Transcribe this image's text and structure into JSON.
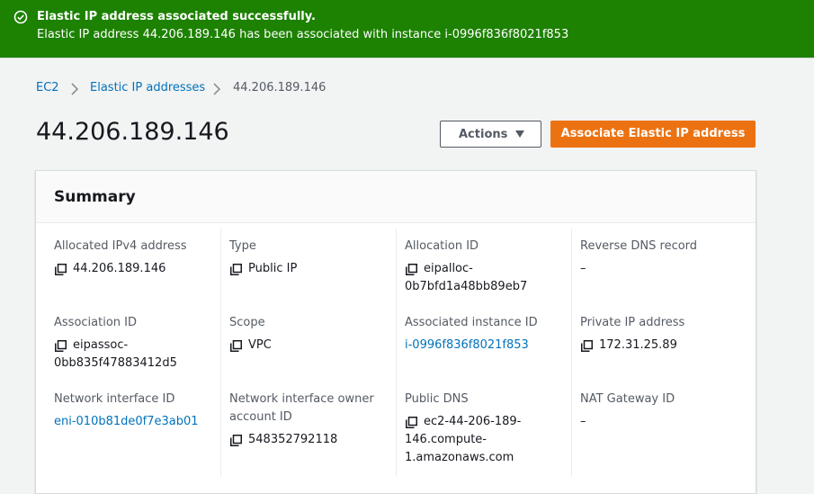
{
  "flash": {
    "title": "Elastic IP address associated successfully.",
    "message": "Elastic IP address 44.206.189.146 has been associated with instance i-0996f836f8021f853",
    "color": "#1d8102"
  },
  "breadcrumb": {
    "items": [
      "EC2",
      "Elastic IP addresses",
      "44.206.189.146"
    ]
  },
  "page": {
    "title": "44.206.189.146"
  },
  "actions": {
    "actions_label": "Actions",
    "associate_label": "Associate Elastic IP address",
    "primary_color": "#ec7211"
  },
  "summary": {
    "heading": "Summary",
    "fields": {
      "allocated_ipv4": {
        "label": "Allocated IPv4 address",
        "value": "44.206.189.146"
      },
      "type": {
        "label": "Type",
        "value": "Public IP"
      },
      "allocation_id": {
        "label": "Allocation ID",
        "value_line1": "eipalloc-",
        "value_line2": "0b7bfd1a48bb89eb7"
      },
      "reverse_dns": {
        "label": "Reverse DNS record",
        "value": "–"
      },
      "association_id": {
        "label": "Association ID",
        "value_line1": "eipassoc-",
        "value_line2": "0bb835f47883412d5"
      },
      "scope": {
        "label": "Scope",
        "value": "VPC"
      },
      "associated_instance": {
        "label": "Associated instance ID",
        "value": "i-0996f836f8021f853"
      },
      "private_ip": {
        "label": "Private IP address",
        "value": "172.31.25.89"
      },
      "eni": {
        "label": "Network interface ID",
        "value": "eni-010b81de0f7e3ab01"
      },
      "eni_owner": {
        "label_line1": "Network interface owner",
        "label_line2": "account ID",
        "value": "548352792118"
      },
      "public_dns": {
        "label": "Public DNS",
        "value_line1": "ec2-44-206-189-",
        "value_line2": "146.compute-",
        "value_line3": "1.amazonaws.com"
      },
      "nat_gateway": {
        "label": "NAT Gateway ID",
        "value": "–"
      }
    }
  },
  "icons": {
    "success": "check-circle-icon",
    "copy": "copy-icon",
    "chevron": "chevron-right-icon",
    "caret": "caret-down-icon"
  }
}
